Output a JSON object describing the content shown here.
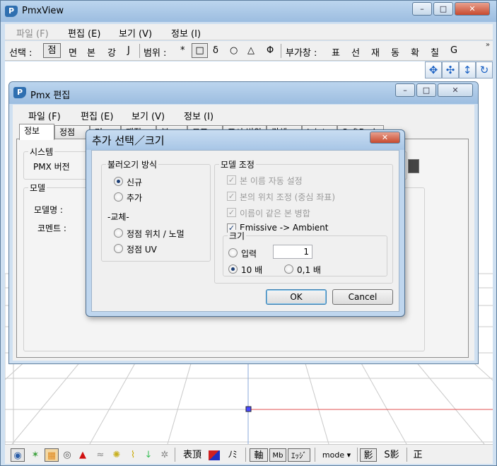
{
  "main": {
    "title": "PmxView",
    "menu": [
      "파일 (F)",
      "편집 (E)",
      "보기 (V)",
      "정보 (I)"
    ],
    "toolbar": {
      "select_label": "선택 :",
      "select_items": [
        "점",
        "면",
        "본",
        "강",
        "J"
      ],
      "range_label": "범위 :",
      "range_items": [
        "*",
        "□",
        "δ",
        "○",
        "△",
        "Φ"
      ],
      "aux_label": "부가창 :",
      "aux_items": [
        "표",
        "선",
        "재",
        "동",
        "확",
        "칠",
        "G"
      ],
      "overflow": "»"
    },
    "status": {
      "items": [
        "表頂",
        "ﾉﾐ",
        "軸",
        "Mb",
        "ｴｯｼﾞ",
        "mode ▾",
        "影",
        "S影",
        "正"
      ]
    }
  },
  "editor": {
    "title": "Pmx 편집",
    "menu": [
      "파일 (F)",
      "편집 (E)",
      "보기 (V)",
      "정보 (I)"
    ],
    "tabs": [
      "정보",
      "정점",
      "면",
      "재질",
      "본",
      "모프",
      "표시 범위",
      "강체",
      "Joint",
      "SoftBody"
    ],
    "system_label": "시스템",
    "pmx_version_label": "PMX 버전",
    "model_label": "모델",
    "model_name_label": "모델명 :",
    "comment_label": "코멘트 :"
  },
  "dialog": {
    "title": "추가 선택／크기",
    "load_method": {
      "label": "불러오기 방식",
      "new": "신규",
      "add": "추가",
      "replace_label": "-교체-",
      "vertex_pos_normal": "정점 위치 / 노멀",
      "vertex_uv": "정점 UV"
    },
    "model_adjust": {
      "label": "모델 조정",
      "auto_bone_name": "본 이름 자동 설정",
      "bone_pos_adjust": "본의 위치 조정 (중심 좌표)",
      "merge_same_bone": "이름이 같은 본 병합",
      "emissive_ambient": "Emissive -> Ambient"
    },
    "size": {
      "label": "크기",
      "input_label": "입력",
      "input_value": "1",
      "x10_label": "10 배",
      "x01_label": "0,1 배"
    },
    "ok": "OK",
    "cancel": "Cancel"
  }
}
